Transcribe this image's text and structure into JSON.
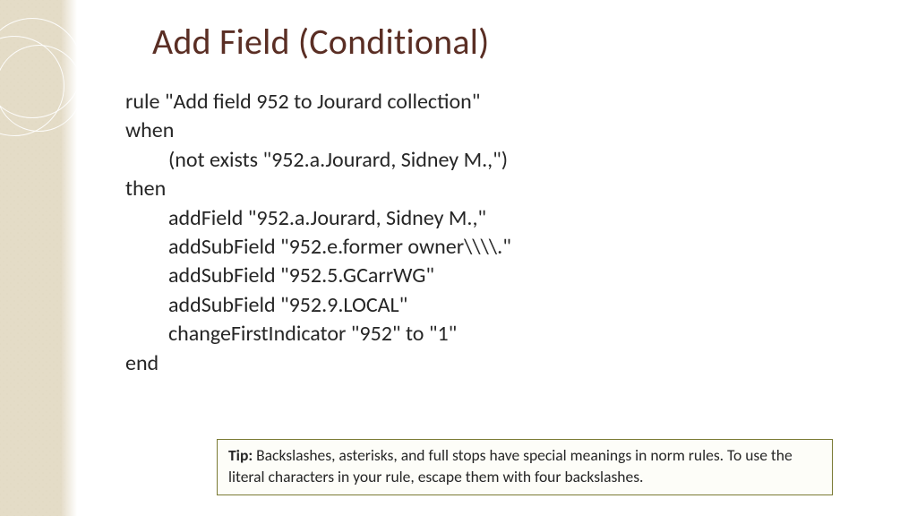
{
  "title": "Add Field (Conditional)",
  "code": {
    "l1": "rule \"Add field 952 to Jourard collection\"",
    "l2": "when",
    "l3": "(not exists \"952.a.Jourard, Sidney M.,\")",
    "l4": "then",
    "l5": "addField \"952.a.Jourard, Sidney M.,\"",
    "l6": "addSubField \"952.e.former owner\\\\\\\\.\"",
    "l7": "addSubField \"952.5.GCarrWG\"",
    "l8": "addSubField \"952.9.LOCAL\"",
    "l9": "changeFirstIndicator \"952\" to \"1\"",
    "l10": "end"
  },
  "tip": {
    "label": "Tip:",
    "text": " Backslashes, asterisks, and full stops have special meanings in norm rules. To use the literal characters in your rule, escape them with four backslashes."
  }
}
